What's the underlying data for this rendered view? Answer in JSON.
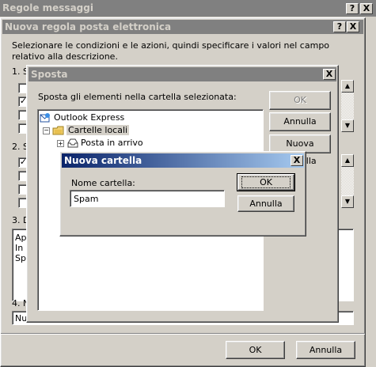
{
  "rules_window": {
    "title": "Regole messaggi",
    "help_btn": "?",
    "close_btn": "X"
  },
  "new_rule_dialog": {
    "title": "Nuova regola posta elettronica",
    "help_btn": "?",
    "close_btn": "X",
    "instructions": "Selezionare le condizioni e le azioni, quindi specificare i valori nel campo relativo alla descrizione.",
    "section1_label": "1. S",
    "section2_label": "2. S",
    "section3_label": "3. D",
    "section4_label": "4. N",
    "description_lines": [
      "Ap",
      "In",
      "Spo"
    ],
    "rule_name_value": "Nu",
    "ok_label": "OK",
    "cancel_label": "Annulla"
  },
  "move_dialog": {
    "title": "Sposta",
    "close_btn": "X",
    "prompt": "Sposta gli elementi nella cartella selezionata:",
    "ok_label": "OK",
    "cancel_label": "Annulla",
    "new_folder_label": "Nuova cartella",
    "tree": [
      {
        "label": "Outlook Express",
        "icon": "outlook-express-icon"
      },
      {
        "label": "Cartelle locali",
        "icon": "local-folders-icon"
      },
      {
        "label": "Posta in arrivo",
        "icon": "inbox-icon"
      }
    ]
  },
  "new_folder_dialog": {
    "title": "Nuova cartella",
    "close_btn": "X",
    "folder_name_label": "Nome cartella:",
    "folder_name_value": "Spam",
    "ok_label": "OK",
    "cancel_label": "Annulla"
  }
}
